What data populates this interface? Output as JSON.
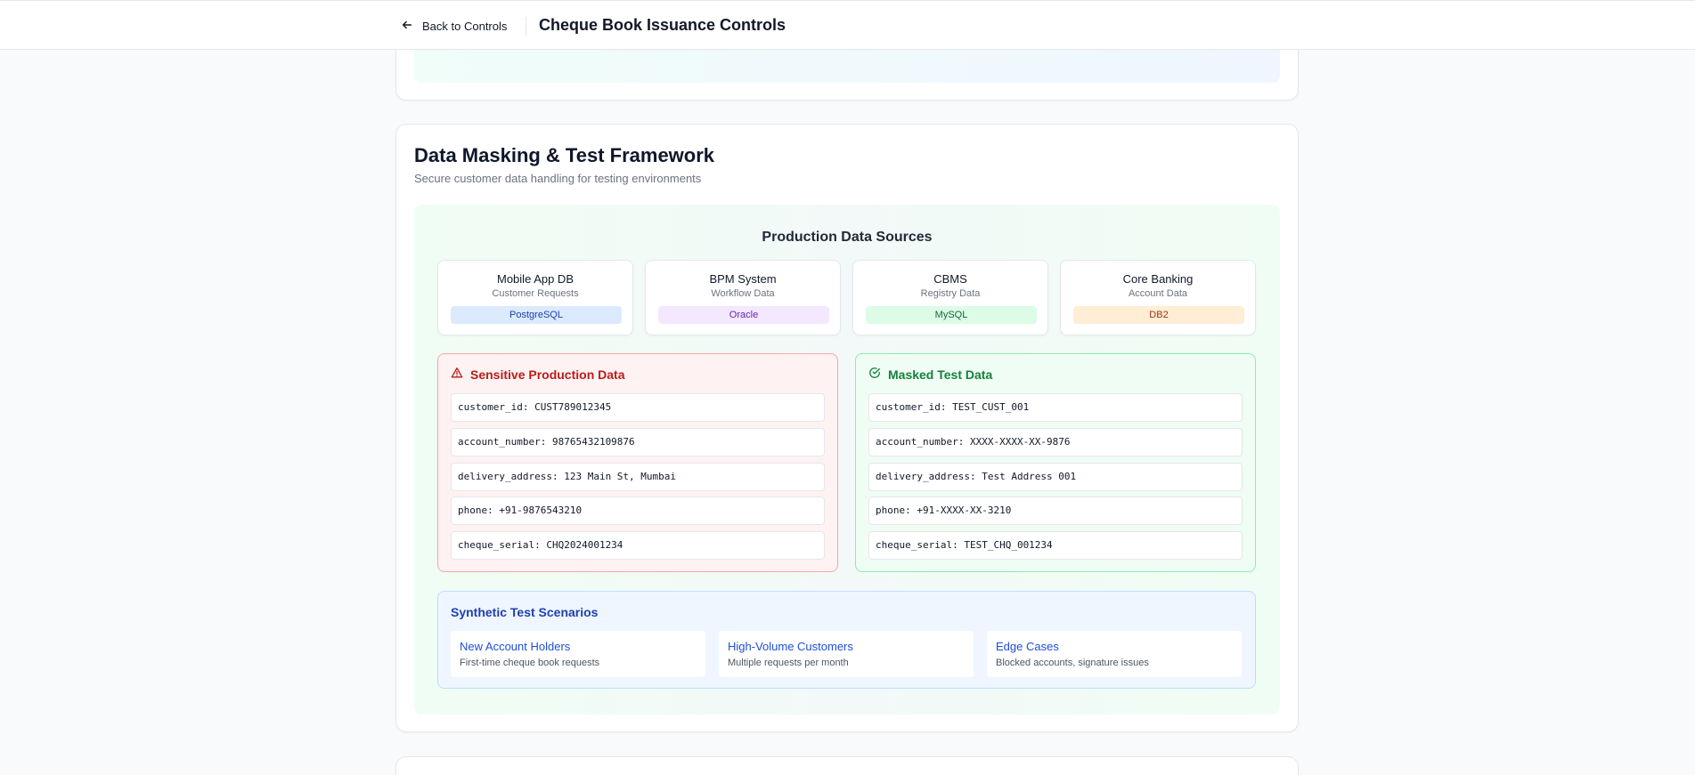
{
  "header": {
    "back_label": "Back to Controls",
    "title": "Cheque Book Issuance Controls"
  },
  "section": {
    "title": "Data Masking & Test Framework",
    "subtitle": "Secure customer data handling for testing environments"
  },
  "production": {
    "heading": "Production Data Sources",
    "sources": [
      {
        "name": "Mobile App DB",
        "desc": "Customer Requests",
        "badge": "PostgreSQL",
        "badge_bg": "#dbeafe",
        "badge_fg": "#1e40af"
      },
      {
        "name": "BPM System",
        "desc": "Workflow Data",
        "badge": "Oracle",
        "badge_bg": "#f3e8ff",
        "badge_fg": "#6b21a8"
      },
      {
        "name": "CBMS",
        "desc": "Registry Data",
        "badge": "MySQL",
        "badge_bg": "#dcfce7",
        "badge_fg": "#166534"
      },
      {
        "name": "Core Banking",
        "desc": "Account Data",
        "badge": "DB2",
        "badge_bg": "#ffedd5",
        "badge_fg": "#9a3412"
      }
    ]
  },
  "sensitive": {
    "title": "Sensitive Production Data",
    "fields": [
      "customer_id: CUST789012345",
      "account_number: 98765432109876",
      "delivery_address: 123 Main St, Mumbai",
      "phone: +91-9876543210",
      "cheque_serial: CHQ2024001234"
    ]
  },
  "masked": {
    "title": "Masked Test Data",
    "fields": [
      "customer_id: TEST_CUST_001",
      "account_number: XXXX-XXXX-XX-9876",
      "delivery_address: Test Address 001",
      "phone: +91-XXXX-XX-3210",
      "cheque_serial: TEST_CHQ_001234"
    ]
  },
  "scenarios": {
    "title": "Synthetic Test Scenarios",
    "items": [
      {
        "name": "New Account Holders",
        "desc": "First-time cheque book requests"
      },
      {
        "name": "High-Volume Customers",
        "desc": "Multiple requests per month"
      },
      {
        "name": "Edge Cases",
        "desc": "Blocked accounts, signature issues"
      }
    ]
  },
  "colors": {
    "sensitive_accent": "#b91c1c",
    "masked_accent": "#15803d",
    "scenario_accent": "#1d4ed8"
  }
}
